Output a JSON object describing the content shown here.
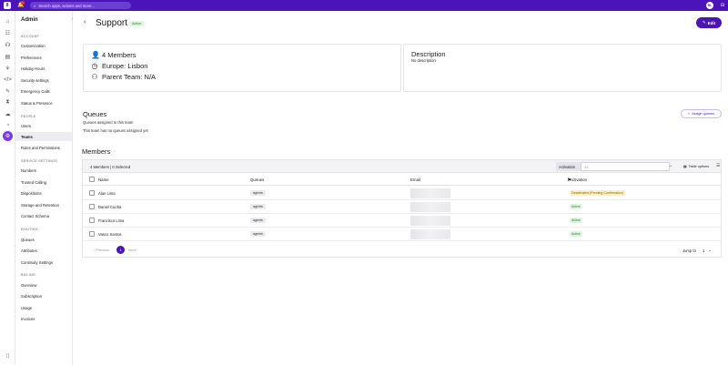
{
  "topbar": {
    "logo": "8",
    "search_placeholder": "Search apps, actions and more...",
    "user_initials": "RL"
  },
  "sidebar": {
    "title": "Admin",
    "sections": [
      {
        "label": "ACCOUNT",
        "items": [
          "Customization",
          "Preferences",
          "Holiday Hours",
          "Security settings",
          "Emergency Calls",
          "Status & Presence"
        ]
      },
      {
        "label": "PEOPLE",
        "items": [
          "Users",
          "Teams",
          "Roles and Permissions"
        ]
      },
      {
        "label": "SERVICE SETTINGS",
        "items": [
          "Numbers",
          "Trusted Calling",
          "Dispositions",
          "Storage and Retention",
          "Contact Schema"
        ]
      },
      {
        "label": "ROUTING",
        "items": [
          "Queues",
          "Attributes",
          "Continuity Settings"
        ]
      },
      {
        "label": "BILLING",
        "items": [
          "Overview",
          "Subscription",
          "Usage",
          "Invoices"
        ]
      }
    ],
    "active_item": "Teams"
  },
  "header": {
    "title": "Support",
    "status": "Active",
    "edit_label": "Edit"
  },
  "team_info": {
    "members": "4 Members",
    "location": "Europe: Lisbon",
    "parent_team": "Parent Team: N/A"
  },
  "description": {
    "title": "Description",
    "value": "No description"
  },
  "queues": {
    "title": "Queues",
    "subtitle": "Queues assigned to this team",
    "empty": "This team has no queues assigned yet",
    "assign_label": "Assign queues"
  },
  "members": {
    "title": "Members",
    "count_label": "4 Members | 0 Selected",
    "filter_label": "Activation",
    "filter_value": "All",
    "table_options": "Table options",
    "columns": [
      "Name",
      "Queues",
      "Email",
      "Activation"
    ],
    "rows": [
      {
        "name": "Alan Lima",
        "queue": "agents",
        "activation": "Deactivated (Pending Confirmation)",
        "status_color": "yellow"
      },
      {
        "name": "Daniel Cunha",
        "queue": "agents",
        "activation": "Active",
        "status_color": "green"
      },
      {
        "name": "Francisco Lima",
        "queue": "agents",
        "activation": "Active",
        "status_color": "green"
      },
      {
        "name": "Vasco Santos",
        "queue": "agents",
        "activation": "Active",
        "status_color": "green"
      }
    ],
    "pagination": {
      "previous": "Previous",
      "current": "1",
      "next": "Next",
      "jump_label": "Jump to",
      "jump_value": "1"
    }
  },
  "colors": {
    "brand": "#4a14b8",
    "active_badge_bg": "#dff5e1",
    "pending_badge_bg": "#fff1c7"
  }
}
